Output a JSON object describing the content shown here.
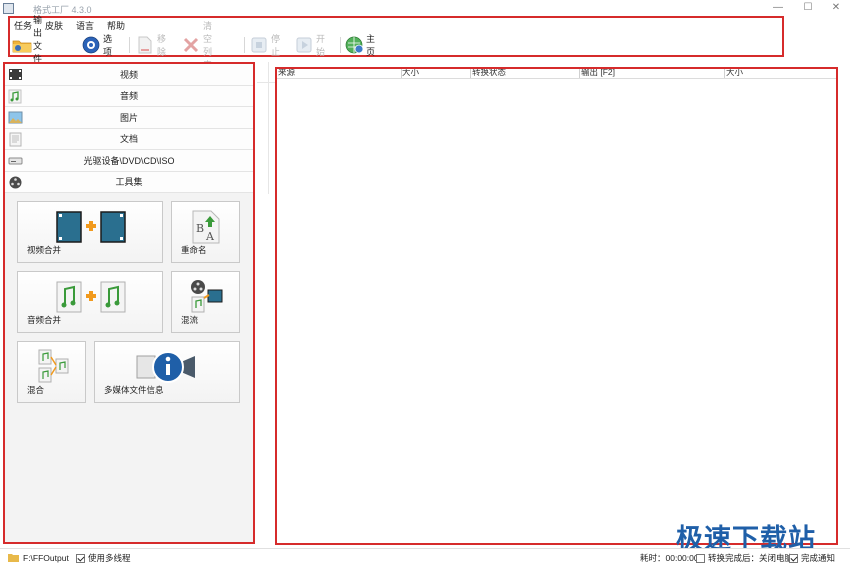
{
  "window": {
    "title": "格式工厂 4.3.0",
    "controls": [
      "—",
      "☐",
      "✕"
    ]
  },
  "menu": [
    "任务",
    "皮肤",
    "语言",
    "帮助"
  ],
  "toolbar": {
    "output_folder": "输出文件夹",
    "options": "选项",
    "remove": "移除",
    "clear_list": "清空列表",
    "stop": "停止",
    "start": "开始",
    "home": "主页"
  },
  "categories": [
    {
      "label": "视频",
      "icon": "film-icon"
    },
    {
      "label": "音频",
      "icon": "music-note-icon"
    },
    {
      "label": "图片",
      "icon": "picture-icon"
    },
    {
      "label": "文档",
      "icon": "document-icon"
    },
    {
      "label": "光驱设备\\DVD\\CD\\ISO",
      "icon": "disc-drive-icon"
    },
    {
      "label": "工具集",
      "icon": "tools-reel-icon"
    }
  ],
  "tools": {
    "video_merge": "视频合并",
    "rename": "重命名",
    "audio_merge": "音频合并",
    "mux": "混流",
    "mix": "混合",
    "media_info": "多媒体文件信息"
  },
  "table": {
    "columns": [
      "来源",
      "大小",
      "转换状态",
      "输出 [F2]",
      "大小"
    ]
  },
  "status": {
    "output_path": "F:\\FFOutput",
    "multithread_label": "使用多线程",
    "multithread_checked": true,
    "elapsed": "耗时：00:00:00",
    "after_convert_label": "转换完成后：关闭电脑",
    "after_convert_checked": false,
    "notify_label": "完成通知",
    "notify_checked": true
  },
  "watermark": "极速下载站",
  "colors": {
    "highlight_border": "#d62b2b",
    "watermark": "#1f5fa8",
    "film": "#2a6f8f",
    "plus": "#f19a1d",
    "music_green": "#3a9a3a"
  }
}
